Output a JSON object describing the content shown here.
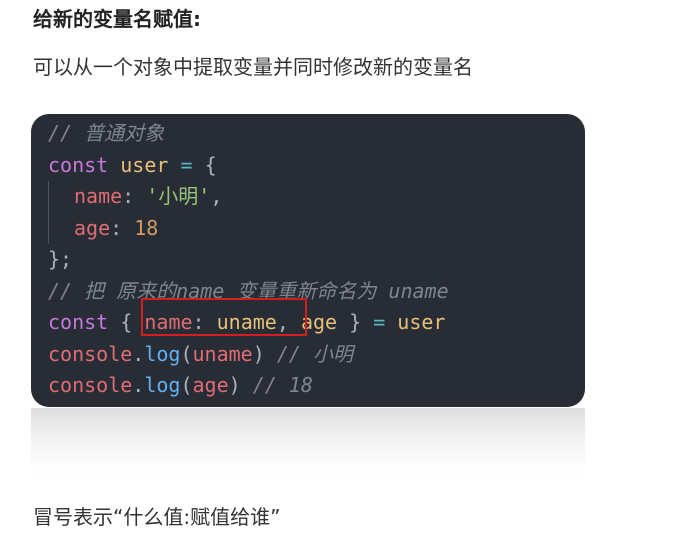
{
  "heading": "给新的变量名赋值:",
  "intro": "可以从一个对象中提取变量并同时修改新的变量名",
  "code": {
    "line1_comment": "// 普通对象",
    "line2_const": "const",
    "line2_user": "user",
    "line2_eq": "=",
    "line2_brace": "{",
    "line3_name": "name",
    "line3_colon": ":",
    "line3_str": "'小明'",
    "line3_comma": ",",
    "line4_age": "age",
    "line4_colon": ":",
    "line4_num": "18",
    "line5_close": "};",
    "line6_comment": "// 把 原来的name 变量重新命名为 uname",
    "line7_const": "const",
    "line7_open": "{",
    "line7_name": "name",
    "line7_colon": ":",
    "line7_uname": "uname",
    "line7_comma": ",",
    "line7_age": "age",
    "line7_close": "}",
    "line7_eq": "=",
    "line7_user": "user",
    "line8_console": "console",
    "line8_dot": ".",
    "line8_log": "log",
    "line8_open": "(",
    "line8_arg": "uname",
    "line8_close": ")",
    "line8_comment": "// 小明",
    "line9_console": "console",
    "line9_dot": ".",
    "line9_log": "log",
    "line9_open": "(",
    "line9_arg": "age",
    "line9_close": ")",
    "line9_comment": "// 18"
  },
  "outro": "冒号表示“什么值:赋值给谁”",
  "colors": {
    "code_bg": "#282c34",
    "highlight": "#d21f1f",
    "keyword": "#c678dd",
    "variable": "#e5c07b",
    "property": "#e06c75",
    "string": "#98c379",
    "number": "#d19a66",
    "function": "#61afef",
    "comment": "#7f848e"
  }
}
